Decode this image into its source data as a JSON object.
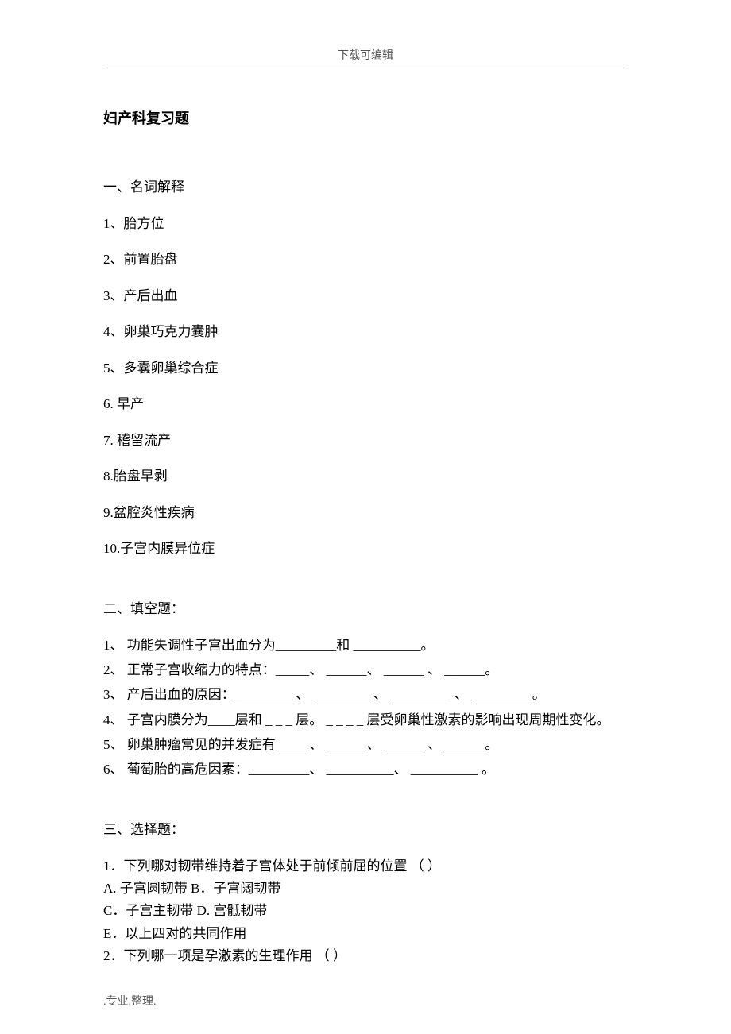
{
  "header": {
    "text": "下载可编辑"
  },
  "title": "妇产科复习题",
  "sections": {
    "s1": {
      "heading": "一、名词解释",
      "items": [
        "1、胎方位",
        "2、前置胎盘",
        "3、产后出血",
        "4、卵巢巧克力囊肿",
        "5、多囊卵巢综合症",
        "6.  早产",
        "7.  稽留流产",
        "8.胎盘早剥",
        "9.盆腔炎性疾病",
        "10.子宫内膜异位症"
      ]
    },
    "s2": {
      "heading": "二、填空题：",
      "items": [
        "1、  功能失调性子宫出血分为_________和  __________。",
        "2、  正常子宫收缩力的特点：_____、   ______、   ______ 、 ______。",
        "3、  产后出血的原因：_________、  _________、   _________ 、 _________。",
        "4、  子宫内膜分为____层和 _ _ _ 层。  _ _ _ _ 层受卵巢性激素的影响出现周期性变化。",
        "5、  卵巢肿瘤常见的并发症有_____、   ______、   ______ 、 ______。",
        "6、  葡萄胎的高危因素：_________、   __________、   __________ 。"
      ]
    },
    "s3": {
      "heading": "三、选择题：",
      "q1": {
        "stem": "1．下列哪对韧带维持着子宫体处于前倾前屈的位置      （         ）",
        "row1": "A.  子宫圆韧带                        B．子宫阔韧带",
        "row2": "C．子宫主韧带                        D.  宫骶韧带",
        "row3": "E．以上四对的共同作用"
      },
      "q2": {
        "stem": "2．下列哪一项是孕激素的生理作用   （        ）"
      }
    }
  },
  "footer": {
    "text": ".专业.整理."
  }
}
